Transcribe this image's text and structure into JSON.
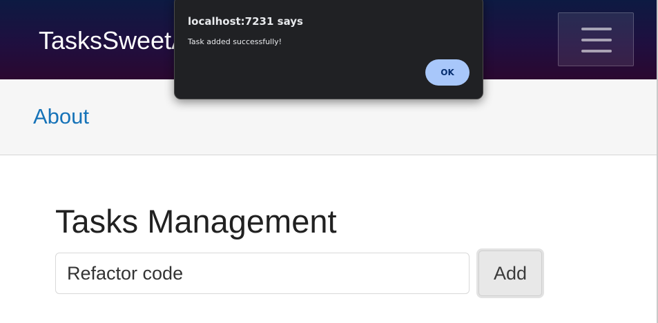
{
  "navbar": {
    "brand": "TasksSweetApp",
    "menu_toggle_icon": "hamburger-menu-icon"
  },
  "subnav": {
    "about_label": "About"
  },
  "main": {
    "title": "Tasks Management",
    "task_input_value": "Refactor code",
    "add_button_label": "Add"
  },
  "alert_dialog": {
    "title": "localhost:7231 says",
    "message": "Task added successfully!",
    "ok_label": "OK"
  },
  "colors": {
    "navbar_gradient_top": "#0d1a42",
    "navbar_gradient_bottom": "#2b0830",
    "link": "#1673b8",
    "dialog_background": "#202124",
    "ok_button": "#a8c7fa"
  }
}
